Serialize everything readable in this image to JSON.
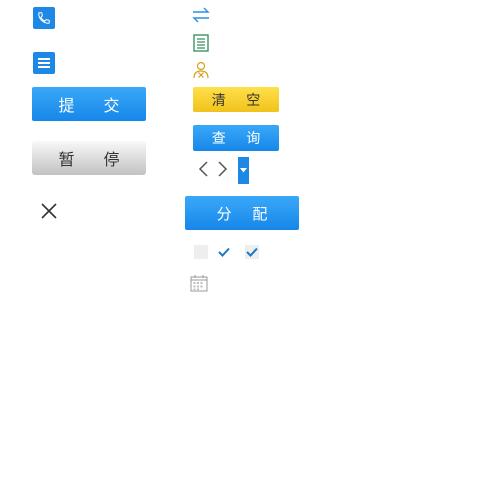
{
  "buttons": {
    "submit": "提 交",
    "pause": "暂 停",
    "clear": "清 空",
    "query": "查 询",
    "assign": "分 配"
  },
  "icons": {
    "phone": "phone-icon",
    "menu": "menu-icon",
    "close": "close-icon",
    "transfer": "transfer-arrows-icon",
    "list": "list-document-icon",
    "user_remove": "user-remove-icon",
    "prev": "chevron-left-icon",
    "next": "chevron-right-icon",
    "dropdown": "dropdown-caret-icon",
    "calendar": "calendar-icon"
  },
  "colors": {
    "primary_blue": "#1e88e5",
    "yellow": "#f5cc26",
    "gray": "#d8d8d8",
    "green": "#2e8b57",
    "orange": "#d4a017"
  },
  "checkboxes": {
    "unchecked": false,
    "checked_plain": true,
    "checked_boxed": true
  }
}
